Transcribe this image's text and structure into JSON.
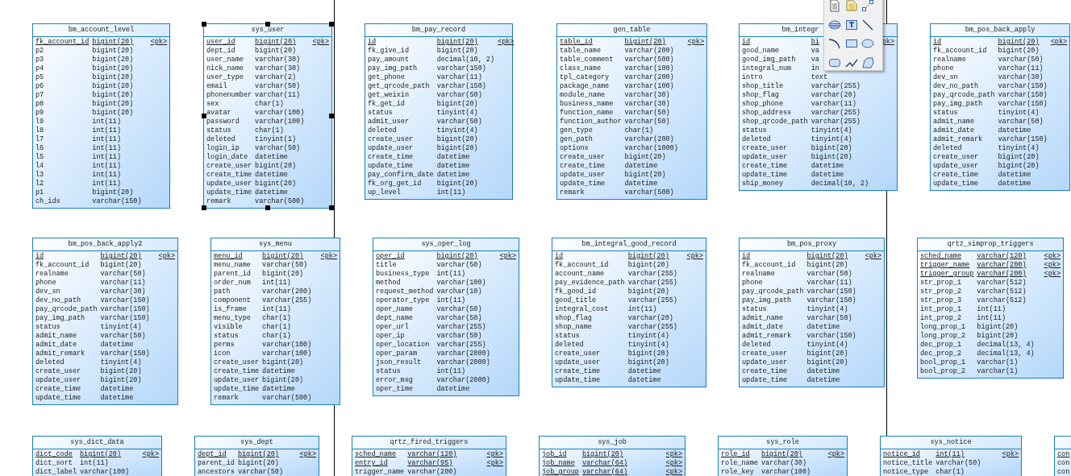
{
  "tables": [
    {
      "title": "bm_account_level",
      "selected": false,
      "fields": [
        {
          "name": "fk_account_id",
          "type": "bigint(20)",
          "primary": true,
          "tag": "<pk>"
        },
        {
          "name": "p2",
          "type": "bigint(20)",
          "primary": false
        },
        {
          "name": "p3",
          "type": "bigint(20)",
          "primary": false
        },
        {
          "name": "p4",
          "type": "bigint(20)",
          "primary": false
        },
        {
          "name": "p5",
          "type": "bigint(20)",
          "primary": false
        },
        {
          "name": "p6",
          "type": "bigint(20)",
          "primary": false
        },
        {
          "name": "p7",
          "type": "bigint(20)",
          "primary": false
        },
        {
          "name": "p8",
          "type": "bigint(20)",
          "primary": false
        },
        {
          "name": "p9",
          "type": "bigint(20)",
          "primary": false
        },
        {
          "name": "l9",
          "type": "int(11)",
          "primary": false
        },
        {
          "name": "l8",
          "type": "int(11)",
          "primary": false
        },
        {
          "name": "l7",
          "type": "int(11)",
          "primary": false
        },
        {
          "name": "l6",
          "type": "int(11)",
          "primary": false
        },
        {
          "name": "l5",
          "type": "int(11)",
          "primary": false
        },
        {
          "name": "l4",
          "type": "int(11)",
          "primary": false
        },
        {
          "name": "l3",
          "type": "int(11)",
          "primary": false
        },
        {
          "name": "l2",
          "type": "int(11)",
          "primary": false
        },
        {
          "name": "p1",
          "type": "bigint(20)",
          "primary": false
        },
        {
          "name": "ch_ids",
          "type": "varchar(150)",
          "primary": false
        }
      ]
    },
    {
      "title": "sys_user",
      "selected": true,
      "fields": [
        {
          "name": "user_id",
          "type": "bigint(20)",
          "primary": true,
          "tag": "<pk>"
        },
        {
          "name": "dept_id",
          "type": "bigint(20)",
          "primary": false
        },
        {
          "name": "user_name",
          "type": "varchar(30)",
          "primary": false
        },
        {
          "name": "nick_name",
          "type": "varchar(30)",
          "primary": false
        },
        {
          "name": "user_type",
          "type": "varchar(2)",
          "primary": false
        },
        {
          "name": "email",
          "type": "varchar(50)",
          "primary": false
        },
        {
          "name": "phonenumber",
          "type": "varchar(11)",
          "primary": false
        },
        {
          "name": "sex",
          "type": "char(1)",
          "primary": false
        },
        {
          "name": "avatar",
          "type": "varchar(100)",
          "primary": false
        },
        {
          "name": "password",
          "type": "varchar(100)",
          "primary": false
        },
        {
          "name": "status",
          "type": "char(1)",
          "primary": false
        },
        {
          "name": "deleted",
          "type": "tinyint(1)",
          "primary": false
        },
        {
          "name": "login_ip",
          "type": "varchar(50)",
          "primary": false
        },
        {
          "name": "login_date",
          "type": "datetime",
          "primary": false
        },
        {
          "name": "create_user",
          "type": "bigint(20)",
          "primary": false
        },
        {
          "name": "create_time",
          "type": "datetime",
          "primary": false
        },
        {
          "name": "update_user",
          "type": "bigint(20)",
          "primary": false
        },
        {
          "name": "update_time",
          "type": "datetime",
          "primary": false
        },
        {
          "name": "remark",
          "type": "varchar(500)",
          "primary": false
        }
      ]
    },
    {
      "title": "bm_pay_record",
      "selected": false,
      "fields": [
        {
          "name": "id",
          "type": "bigint(20)",
          "primary": true,
          "tag": "<pk>"
        },
        {
          "name": "fk_give_id",
          "type": "bigint(20)",
          "primary": false
        },
        {
          "name": "pay_amount",
          "type": "decimal(10, 2)",
          "primary": false
        },
        {
          "name": "pay_img_path",
          "type": "varchar(150)",
          "primary": false
        },
        {
          "name": "get_phone",
          "type": "varchar(11)",
          "primary": false
        },
        {
          "name": "get_qrcode_path",
          "type": "varchar(150)",
          "primary": false
        },
        {
          "name": "get_weixin",
          "type": "varchar(50)",
          "primary": false
        },
        {
          "name": "fk_get_id",
          "type": "bigint(20)",
          "primary": false
        },
        {
          "name": "status",
          "type": "tinyint(4)",
          "primary": false
        },
        {
          "name": "admit_user",
          "type": "varchar(50)",
          "primary": false
        },
        {
          "name": "deleted",
          "type": "tinyint(4)",
          "primary": false
        },
        {
          "name": "create_user",
          "type": "bigint(20)",
          "primary": false
        },
        {
          "name": "update_user",
          "type": "bigint(20)",
          "primary": false
        },
        {
          "name": "create_time",
          "type": "datetime",
          "primary": false
        },
        {
          "name": "update_time",
          "type": "datetime",
          "primary": false
        },
        {
          "name": "pay_confirm_date",
          "type": "datetime",
          "primary": false
        },
        {
          "name": "fk_org_get_id",
          "type": "bigint(20)",
          "primary": false
        },
        {
          "name": "up_level",
          "type": "int(11)",
          "primary": false
        }
      ]
    },
    {
      "title": "gen_table",
      "selected": false,
      "fields": [
        {
          "name": "table_id",
          "type": "bigint(20)",
          "primary": true,
          "tag": "<pk>"
        },
        {
          "name": "table_name",
          "type": "varchar(200)",
          "primary": false
        },
        {
          "name": "table_comment",
          "type": "varchar(500)",
          "primary": false
        },
        {
          "name": "class_name",
          "type": "varchar(100)",
          "primary": false
        },
        {
          "name": "tpl_category",
          "type": "varchar(200)",
          "primary": false
        },
        {
          "name": "package_name",
          "type": "varchar(100)",
          "primary": false
        },
        {
          "name": "module_name",
          "type": "varchar(30)",
          "primary": false
        },
        {
          "name": "business_name",
          "type": "varchar(30)",
          "primary": false
        },
        {
          "name": "function_name",
          "type": "varchar(50)",
          "primary": false
        },
        {
          "name": "function_author",
          "type": "varchar(50)",
          "primary": false
        },
        {
          "name": "gen_type",
          "type": "char(1)",
          "primary": false
        },
        {
          "name": "gen_path",
          "type": "varchar(200)",
          "primary": false
        },
        {
          "name": "options",
          "type": "varchar(1000)",
          "primary": false
        },
        {
          "name": "create_user",
          "type": "bigint(20)",
          "primary": false
        },
        {
          "name": "create_time",
          "type": "datetime",
          "primary": false
        },
        {
          "name": "update_user",
          "type": "bigint(20)",
          "primary": false
        },
        {
          "name": "update_time",
          "type": "datetime",
          "primary": false
        },
        {
          "name": "remark",
          "type": "varchar(500)",
          "primary": false
        }
      ]
    },
    {
      "title": "bm_integr",
      "selected": false,
      "fields": [
        {
          "name": "id",
          "type": "bi",
          "primary": true,
          "tag": "pk>"
        },
        {
          "name": "good_name",
          "type": "va",
          "primary": false
        },
        {
          "name": "good_img_path",
          "type": "va",
          "primary": false
        },
        {
          "name": "integral_num",
          "type": "in",
          "primary": false
        },
        {
          "name": "intro",
          "type": "text",
          "primary": false
        },
        {
          "name": "shop_title",
          "type": "varchar(255)",
          "primary": false
        },
        {
          "name": "shop_flag",
          "type": "varchar(20)",
          "primary": false
        },
        {
          "name": "shop_phone",
          "type": "varchar(11)",
          "primary": false
        },
        {
          "name": "shop_address",
          "type": "varchar(255)",
          "primary": false
        },
        {
          "name": "shop_qrcode_path",
          "type": "varchar(255)",
          "primary": false
        },
        {
          "name": "status",
          "type": "tinyint(4)",
          "primary": false
        },
        {
          "name": "deleted",
          "type": "tinyint(4)",
          "primary": false
        },
        {
          "name": "create_user",
          "type": "bigint(20)",
          "primary": false
        },
        {
          "name": "update_user",
          "type": "bigint(20)",
          "primary": false
        },
        {
          "name": "create_time",
          "type": "datetime",
          "primary": false
        },
        {
          "name": "update_time",
          "type": "datetime",
          "primary": false
        },
        {
          "name": "ship_money",
          "type": "decimal(10, 2)",
          "primary": false
        }
      ]
    },
    {
      "title": "bm_pos_back_apply",
      "selected": false,
      "fields": [
        {
          "name": "id",
          "type": "bigint(20)",
          "primary": true,
          "tag": "<pk>"
        },
        {
          "name": "fk_account_id",
          "type": "bigint(20)",
          "primary": false
        },
        {
          "name": "realname",
          "type": "varchar(50)",
          "primary": false
        },
        {
          "name": "phone",
          "type": "varchar(11)",
          "primary": false
        },
        {
          "name": "dev_sn",
          "type": "varchar(30)",
          "primary": false
        },
        {
          "name": "dev_no_path",
          "type": "varchar(150)",
          "primary": false
        },
        {
          "name": "pay_qrcode_path",
          "type": "varchar(150)",
          "primary": false
        },
        {
          "name": "pay_img_path",
          "type": "varchar(150)",
          "primary": false
        },
        {
          "name": "status",
          "type": "tinyint(4)",
          "primary": false
        },
        {
          "name": "admit_name",
          "type": "varchar(50)",
          "primary": false
        },
        {
          "name": "admit_date",
          "type": "datetime",
          "primary": false
        },
        {
          "name": "admit_remark",
          "type": "varchar(150)",
          "primary": false
        },
        {
          "name": "deleted",
          "type": "tinyint(4)",
          "primary": false
        },
        {
          "name": "create_user",
          "type": "bigint(20)",
          "primary": false
        },
        {
          "name": "update_user",
          "type": "bigint(20)",
          "primary": false
        },
        {
          "name": "create_time",
          "type": "datetime",
          "primary": false
        },
        {
          "name": "update_time",
          "type": "datetime",
          "primary": false
        }
      ]
    },
    {
      "title": "bm_pos_back_apply2",
      "selected": false,
      "fields": [
        {
          "name": "id",
          "type": "bigint(20)",
          "primary": true,
          "tag": "<pk>"
        },
        {
          "name": "fk_account_id",
          "type": "bigint(20)",
          "primary": false
        },
        {
          "name": "realname",
          "type": "varchar(50)",
          "primary": false
        },
        {
          "name": "phone",
          "type": "varchar(11)",
          "primary": false
        },
        {
          "name": "dev_sn",
          "type": "varchar(30)",
          "primary": false
        },
        {
          "name": "dev_no_path",
          "type": "varchar(150)",
          "primary": false
        },
        {
          "name": "pay_qrcode_path",
          "type": "varchar(150)",
          "primary": false
        },
        {
          "name": "pay_img_path",
          "type": "varchar(150)",
          "primary": false
        },
        {
          "name": "status",
          "type": "tinyint(4)",
          "primary": false
        },
        {
          "name": "admit_name",
          "type": "varchar(50)",
          "primary": false
        },
        {
          "name": "admit_date",
          "type": "datetime",
          "primary": false
        },
        {
          "name": "admit_remark",
          "type": "varchar(150)",
          "primary": false
        },
        {
          "name": "deleted",
          "type": "tinyint(4)",
          "primary": false
        },
        {
          "name": "create_user",
          "type": "bigint(20)",
          "primary": false
        },
        {
          "name": "update_user",
          "type": "bigint(20)",
          "primary": false
        },
        {
          "name": "create_time",
          "type": "datetime",
          "primary": false
        },
        {
          "name": "update_time",
          "type": "datetime",
          "primary": false
        }
      ]
    },
    {
      "title": "sys_menu",
      "selected": false,
      "fields": [
        {
          "name": "menu_id",
          "type": "bigint(20)",
          "primary": true,
          "tag": "<pk>"
        },
        {
          "name": "menu_name",
          "type": "varchar(50)",
          "primary": false
        },
        {
          "name": "parent_id",
          "type": "bigint(20)",
          "primary": false
        },
        {
          "name": "order_num",
          "type": "int(11)",
          "primary": false
        },
        {
          "name": "path",
          "type": "varchar(200)",
          "primary": false
        },
        {
          "name": "component",
          "type": "varchar(255)",
          "primary": false
        },
        {
          "name": "is_frame",
          "type": "int(11)",
          "primary": false
        },
        {
          "name": "menu_type",
          "type": "char(1)",
          "primary": false
        },
        {
          "name": "visible",
          "type": "char(1)",
          "primary": false
        },
        {
          "name": "status",
          "type": "char(1)",
          "primary": false
        },
        {
          "name": "perms",
          "type": "varchar(100)",
          "primary": false
        },
        {
          "name": "icon",
          "type": "varchar(100)",
          "primary": false
        },
        {
          "name": "create_user",
          "type": "bigint(20)",
          "primary": false
        },
        {
          "name": "create_time",
          "type": "datetime",
          "primary": false
        },
        {
          "name": "update_user",
          "type": "bigint(20)",
          "primary": false
        },
        {
          "name": "update_time",
          "type": "datetime",
          "primary": false
        },
        {
          "name": "remark",
          "type": "varchar(500)",
          "primary": false
        }
      ]
    },
    {
      "title": "sys_oper_log",
      "selected": false,
      "fields": [
        {
          "name": "oper_id",
          "type": "bigint(20)",
          "primary": true,
          "tag": "<pk>"
        },
        {
          "name": "title",
          "type": "varchar(50)",
          "primary": false
        },
        {
          "name": "business_type",
          "type": "int(11)",
          "primary": false
        },
        {
          "name": "method",
          "type": "varchar(100)",
          "primary": false
        },
        {
          "name": "request_method",
          "type": "varchar(10)",
          "primary": false
        },
        {
          "name": "operator_type",
          "type": "int(11)",
          "primary": false
        },
        {
          "name": "oper_name",
          "type": "varchar(50)",
          "primary": false
        },
        {
          "name": "dept_name",
          "type": "varchar(50)",
          "primary": false
        },
        {
          "name": "oper_url",
          "type": "varchar(255)",
          "primary": false
        },
        {
          "name": "oper_ip",
          "type": "varchar(50)",
          "primary": false
        },
        {
          "name": "oper_location",
          "type": "varchar(255)",
          "primary": false
        },
        {
          "name": "oper_param",
          "type": "varchar(2000)",
          "primary": false
        },
        {
          "name": "json_result",
          "type": "varchar(2000)",
          "primary": false
        },
        {
          "name": "status",
          "type": "int(11)",
          "primary": false
        },
        {
          "name": "error_msg",
          "type": "varchar(2000)",
          "primary": false
        },
        {
          "name": "oper_time",
          "type": "datetime",
          "primary": false
        }
      ]
    },
    {
      "title": "bm_integral_good_record",
      "selected": false,
      "fields": [
        {
          "name": "id",
          "type": "bigint(20)",
          "primary": true,
          "tag": "<pk>"
        },
        {
          "name": "fk_account_id",
          "type": "bigint(20)",
          "primary": false
        },
        {
          "name": "account_name",
          "type": "varchar(255)",
          "primary": false
        },
        {
          "name": "pay_evidence_path",
          "type": "varchar(255)",
          "primary": false
        },
        {
          "name": "fk_good_id",
          "type": "bigint(20)",
          "primary": false
        },
        {
          "name": "good_title",
          "type": "varchar(255)",
          "primary": false
        },
        {
          "name": "integral_cost",
          "type": "int(11)",
          "primary": false
        },
        {
          "name": "shop_flag",
          "type": "varchar(20)",
          "primary": false
        },
        {
          "name": "shop_name",
          "type": "varchar(255)",
          "primary": false
        },
        {
          "name": "status",
          "type": "tinyint(4)",
          "primary": false
        },
        {
          "name": "deleted",
          "type": "tinyint(4)",
          "primary": false
        },
        {
          "name": "create_user",
          "type": "bigint(20)",
          "primary": false
        },
        {
          "name": "update_user",
          "type": "bigint(20)",
          "primary": false
        },
        {
          "name": "create_time",
          "type": "datetime",
          "primary": false
        },
        {
          "name": "update_time",
          "type": "datetime",
          "primary": false
        }
      ]
    },
    {
      "title": "bm_pos_proxy",
      "selected": false,
      "fields": [
        {
          "name": "id",
          "type": "bigint(20)",
          "primary": true,
          "tag": "<pk>"
        },
        {
          "name": "fk_account_id",
          "type": "bigint(20)",
          "primary": false
        },
        {
          "name": "realname",
          "type": "varchar(50)",
          "primary": false
        },
        {
          "name": "phone",
          "type": "varchar(11)",
          "primary": false
        },
        {
          "name": "pay_qrcode_path",
          "type": "varchar(150)",
          "primary": false
        },
        {
          "name": "pay_img_path",
          "type": "varchar(150)",
          "primary": false
        },
        {
          "name": "status",
          "type": "tinyint(4)",
          "primary": false
        },
        {
          "name": "admit_name",
          "type": "varchar(50)",
          "primary": false
        },
        {
          "name": "admit_date",
          "type": "datetime",
          "primary": false
        },
        {
          "name": "admit_remark",
          "type": "varchar(150)",
          "primary": false
        },
        {
          "name": "deleted",
          "type": "tinyint(4)",
          "primary": false
        },
        {
          "name": "create_user",
          "type": "bigint(20)",
          "primary": false
        },
        {
          "name": "update_user",
          "type": "bigint(20)",
          "primary": false
        },
        {
          "name": "create_time",
          "type": "datetime",
          "primary": false
        },
        {
          "name": "update_time",
          "type": "datetime",
          "primary": false
        }
      ]
    },
    {
      "title": "qrtz_simprop_triggers",
      "selected": false,
      "fields": [
        {
          "name": "sched_name",
          "type": "varchar(120)",
          "primary": true,
          "tag": "<pk>"
        },
        {
          "name": "trigger_name",
          "type": "varchar(200)",
          "primary": true,
          "tag": "<pk>"
        },
        {
          "name": "trigger_group",
          "type": "varchar(200)",
          "primary": true,
          "tag": "<pk>"
        },
        {
          "name": "str_prop_1",
          "type": "varchar(512)",
          "primary": false
        },
        {
          "name": "str_prop_2",
          "type": "varchar(512)",
          "primary": false
        },
        {
          "name": "str_prop_3",
          "type": "varchar(512)",
          "primary": false
        },
        {
          "name": "int_prop_1",
          "type": "int(11)",
          "primary": false
        },
        {
          "name": "int_prop_2",
          "type": "int(11)",
          "primary": false
        },
        {
          "name": "long_prop_1",
          "type": "bigint(20)",
          "primary": false
        },
        {
          "name": "long_prop_2",
          "type": "bigint(20)",
          "primary": false
        },
        {
          "name": "dec_prop_1",
          "type": "decimal(13, 4)",
          "primary": false
        },
        {
          "name": "dec_prop_2",
          "type": "decimal(13, 4)",
          "primary": false
        },
        {
          "name": "bool_prop_1",
          "type": "varchar(1)",
          "primary": false
        },
        {
          "name": "bool_prop_2",
          "type": "varchar(1)",
          "primary": false
        }
      ]
    },
    {
      "title": "sys_dict_data",
      "selected": false,
      "fields": [
        {
          "name": "dict_code",
          "type": "bigint(20)",
          "primary": true,
          "tag": "<pk>"
        },
        {
          "name": "dict_sort",
          "type": "int(11)",
          "primary": false
        },
        {
          "name": "dict_label",
          "type": "varchar(100)",
          "primary": false
        }
      ]
    },
    {
      "title": "sys_dept",
      "selected": false,
      "fields": [
        {
          "name": "dept_id",
          "type": "bigint(20)",
          "primary": true,
          "tag": "<pk>"
        },
        {
          "name": "parent_id",
          "type": "bigint(20)",
          "primary": false
        },
        {
          "name": "ancestors",
          "type": "varchar(50)",
          "primary": false
        }
      ]
    },
    {
      "title": "qrtz_fired_triggers",
      "selected": false,
      "fields": [
        {
          "name": "sched_name",
          "type": "varchar(120)",
          "primary": true,
          "tag": "<pk>"
        },
        {
          "name": "entry_id",
          "type": "varchar(95)",
          "primary": true,
          "tag": "<pk>"
        },
        {
          "name": "trigger_name",
          "type": "varchar(200)",
          "primary": false
        }
      ]
    },
    {
      "title": "sys_job",
      "selected": false,
      "fields": [
        {
          "name": "job_id",
          "type": "bigint(20)",
          "primary": true,
          "tag": "<pk>"
        },
        {
          "name": "job_name",
          "type": "varchar(64)",
          "primary": true,
          "tag": "<pk>"
        },
        {
          "name": "job_group",
          "type": "varchar(64)",
          "primary": true,
          "tag": "<pk>"
        }
      ]
    },
    {
      "title": "sys_role",
      "selected": false,
      "fields": [
        {
          "name": "role_id",
          "type": "bigint(20)",
          "primary": true,
          "tag": "<pk>"
        },
        {
          "name": "role_name",
          "type": "varchar(30)",
          "primary": false
        },
        {
          "name": "role_key",
          "type": "varchar(100)",
          "primary": false
        }
      ]
    },
    {
      "title": "sys_notice",
      "selected": false,
      "fields": [
        {
          "name": "notice_id",
          "type": "int(11)",
          "primary": true,
          "tag": "<pk>"
        },
        {
          "name": "notice_title",
          "type": "varchar(50)",
          "primary": false
        },
        {
          "name": "notice_type",
          "type": "char(1)",
          "primary": false
        }
      ]
    },
    {
      "selected": false,
      "fields": [
        {
          "name": "con",
          "primary": true
        },
        {
          "name": "con",
          "primary": false
        },
        {
          "name": "con",
          "primary": false
        }
      ]
    }
  ]
}
